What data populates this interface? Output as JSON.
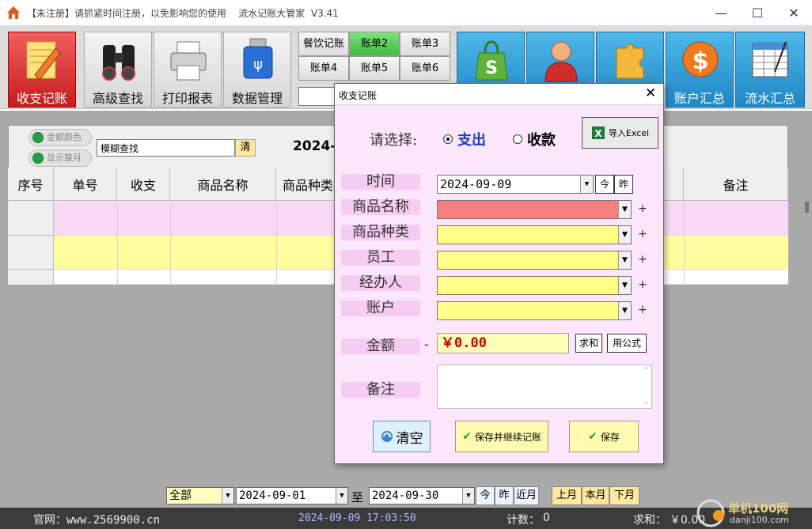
{
  "window": {
    "title": "【未注册】请抓紧时间注册，以免影响您的使用    流水记账大管家  V3.41"
  },
  "toolbar": {
    "left_buttons": [
      {
        "label": "收支记账",
        "icon": "pencil-notepad-icon",
        "active": true
      },
      {
        "label": "高级查找",
        "icon": "binoculars-icon"
      },
      {
        "label": "打印报表",
        "icon": "printer-icon"
      },
      {
        "label": "数据管理",
        "icon": "usb-drive-icon"
      }
    ],
    "accounts": [
      "餐饮记账",
      "账单2",
      "账单3",
      "账单4",
      "账单5",
      "账单6"
    ],
    "accounts_selected": "账单2",
    "right_buttons": [
      {
        "label": "",
        "icon": "shopping-bag-icon"
      },
      {
        "label": "",
        "icon": "person-icon"
      },
      {
        "label": "",
        "icon": "puzzle-icon"
      },
      {
        "label": "账户汇总",
        "icon": "dollar-icon"
      },
      {
        "label": "流水汇总",
        "icon": "spreadsheet-icon"
      }
    ]
  },
  "list": {
    "toggle_amount_color": "金额颜色",
    "toggle_show_month": "显示整月",
    "fuzzy_search_value": "模糊查找",
    "clear_label": "清",
    "month_title": "2024-",
    "columns": [
      "序号",
      "单号",
      "收支",
      "商品名称",
      "商品种类"
    ],
    "remarks_column": "备注"
  },
  "dialog": {
    "title": "收支记账",
    "choose_label": "请选择:",
    "option_expense": "支出",
    "option_income": "收款",
    "selected_option": "支出",
    "import_excel": "导入Excel",
    "fields": {
      "time_label": "时间",
      "time_value": "2024-09-09",
      "today_btn": "今",
      "yesterday_btn": "昨",
      "product_name_label": "商品名称",
      "product_type_label": "商品种类",
      "staff_label": "员工",
      "handler_label": "经办人",
      "account_label": "账户",
      "amount_label": "金额",
      "amount_sign": "-",
      "amount_value": "￥0.00",
      "sum_btn": "求和",
      "formula_btn": "用公式",
      "remarks_label": "备注"
    },
    "clear_btn": "清空",
    "save_continue_btn": "保存并继续记账",
    "save_btn": "保存"
  },
  "filter": {
    "scope": "全部",
    "date_from": "2024-09-01",
    "to_label": "至",
    "date_to": "2024-09-30",
    "today": "今",
    "yesterday": "昨",
    "recent_month": "近月",
    "last_month": "上月",
    "this_month": "本月",
    "next_month": "下月"
  },
  "status": {
    "website": "官网：www.2569900.cn",
    "datetime": "2024-09-09 17:03:50",
    "count_label": "计数：",
    "count_value": "0",
    "sum_label": "求和：",
    "sum_value": "￥0.00"
  },
  "watermark": {
    "site_name": "单机100网",
    "site_url": "danji100.com"
  },
  "colors": {
    "active_button": "#d92d2d",
    "selected_account": "#4fc94f",
    "dialog_bg": "#fbe6fb",
    "required_field": "#f77f7f",
    "field_fill": "#ffff88",
    "amount_text": "#cc0000"
  }
}
